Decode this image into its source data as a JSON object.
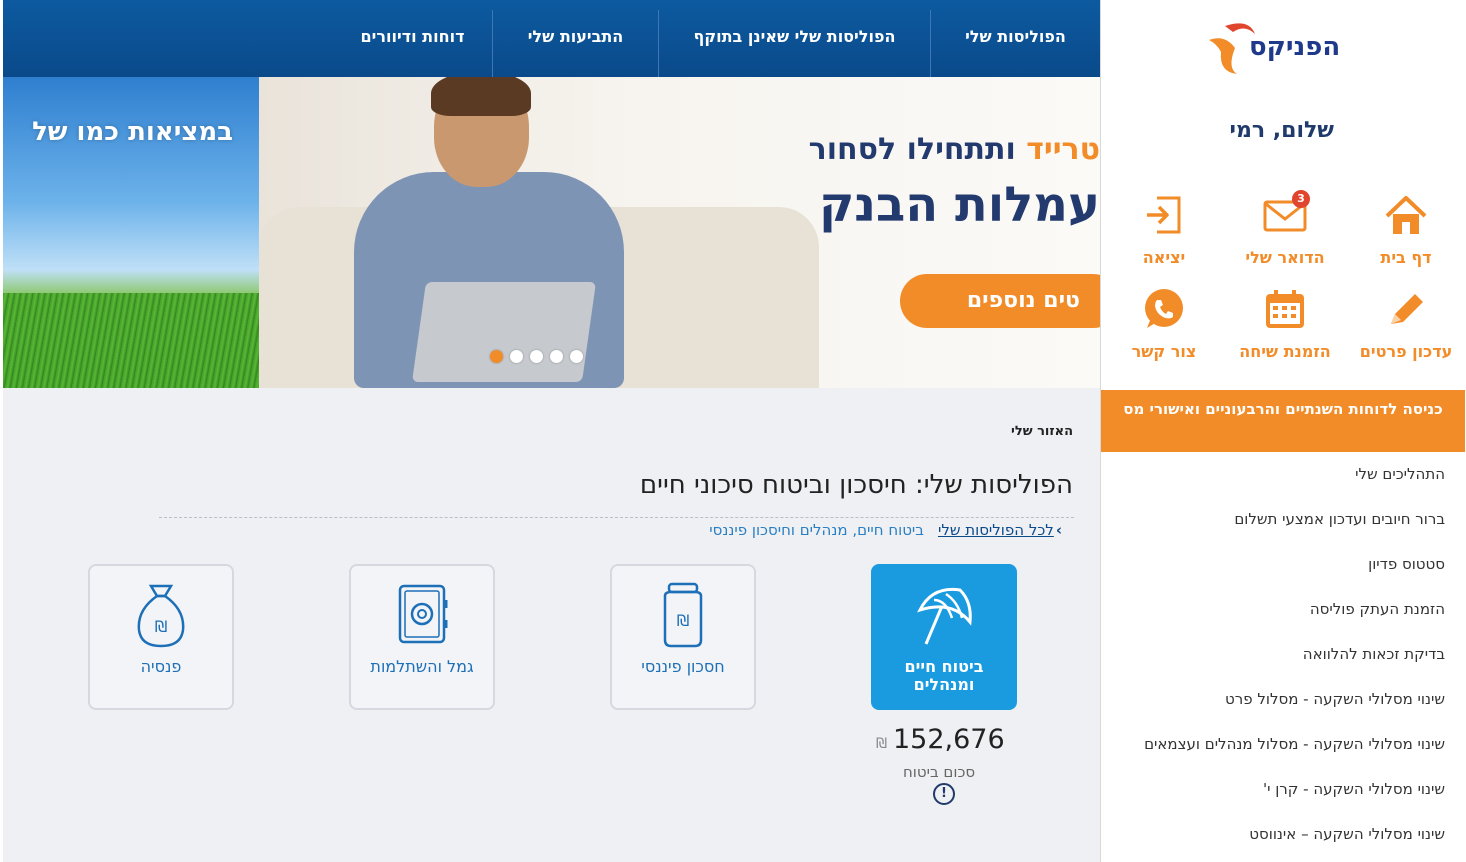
{
  "brand": {
    "logo_text": "הפניקס",
    "accent_color": "#f28c28",
    "primary_color": "#0b4a8b"
  },
  "sidebar": {
    "greeting": "שלום, רמי",
    "quick_actions": [
      {
        "label": "דף בית",
        "icon": "home-icon"
      },
      {
        "label": "הדואר שלי",
        "icon": "mail-icon",
        "badge": "3"
      },
      {
        "label": "יציאה",
        "icon": "logout-icon"
      },
      {
        "label": "עדכון פרטים",
        "icon": "pencil-icon"
      },
      {
        "label": "הזמנת שיחה",
        "icon": "calendar-icon"
      },
      {
        "label": "צור קשר",
        "icon": "phone-icon"
      }
    ],
    "reports_button": "כניסה לדוחות השנתיים והרבעוניים ואישורי מס",
    "menu": [
      "התהליכים שלי",
      "ברור חיובים ועדכון אמצעי תשלום",
      "סטטוס פדיון",
      "הזמנת העתק פוליסה",
      "בדיקת זכאות להלוואה",
      "שינוי מסלולי השקעה - מסלול פרט",
      "שינוי מסלולי השקעה - מסלול מנהלים ועצמאים",
      "שינוי מסלולי השקעה - קרן י'",
      "שינוי מסלולי השקעה – אינווסט"
    ]
  },
  "topnav": {
    "tabs": [
      "הפוליסות שלי",
      "הפוליסות שלי שאינן בתוקף",
      "התביעות שלי",
      "דוחות ודיוורים"
    ]
  },
  "banner": {
    "left_text": "במציאות כמו של",
    "headline_accent": "טרייד",
    "headline_rest": " ותתחילו לסחור",
    "headline_big": "עמלות הבנק",
    "cta": "טים נוספים",
    "slide_count": 5,
    "active_slide": 1
  },
  "main": {
    "breadcrumb": "האזור שלי",
    "title": "הפוליסות שלי: חיסכון וביטוח סיכוני חיים",
    "all_policies_link": "לכל הפוליסות שלי",
    "current_section": "ביטוח חיים, מנהלים וחיסכון פיננסי",
    "cards": [
      {
        "label": "ביטוח חיים ומנהלים",
        "icon": "umbrella-icon",
        "active": true
      },
      {
        "label": "חסכון פיננסי",
        "icon": "savings-jar-icon",
        "active": false
      },
      {
        "label": "גמל והשתלמות",
        "icon": "safe-icon",
        "active": false
      },
      {
        "label": "פנסיה",
        "icon": "money-bag-icon",
        "active": false
      }
    ],
    "amount": "152,676",
    "currency_symbol": "₪",
    "amount_label": "סכום ביטוח",
    "info_symbol": "!"
  }
}
